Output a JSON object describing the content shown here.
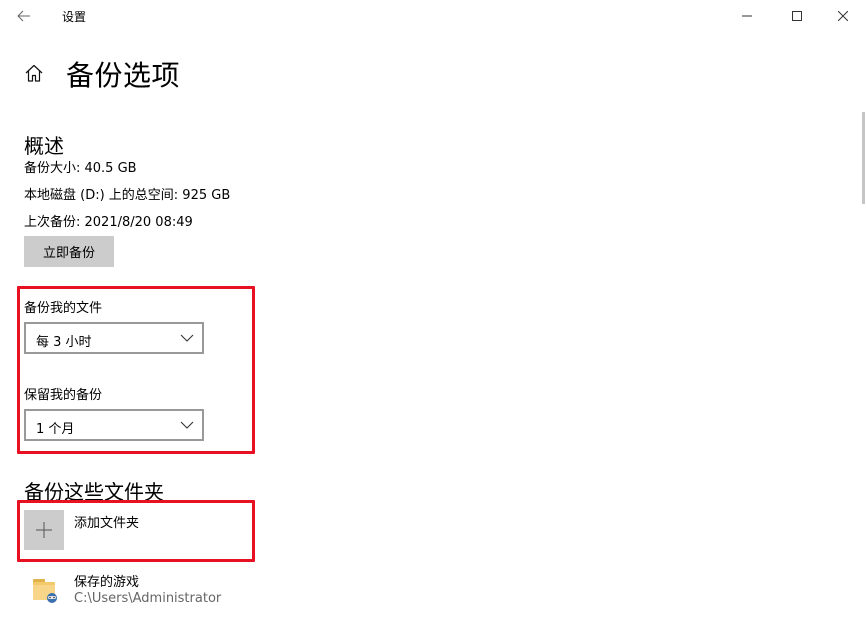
{
  "window": {
    "title": "设置"
  },
  "page": {
    "title": "备份选项"
  },
  "overview": {
    "title": "概述",
    "backup_size": "备份大小: 40.5 GB",
    "total_space": "本地磁盘 (D:) 上的总空间: 925 GB",
    "last_backup": "上次备份: 2021/8/20 08:49",
    "backup_now_label": "立即备份"
  },
  "settings": {
    "frequency_label": "备份我的文件",
    "frequency_value": "每 3 小时",
    "retention_label": "保留我的备份",
    "retention_value": "1 个月"
  },
  "folders": {
    "title": "备份这些文件夹",
    "add_label": "添加文件夹",
    "items": [
      {
        "name": "保存的游戏",
        "path": "C:\\Users\\Administrator"
      }
    ]
  },
  "colors": {
    "highlight": "#e81123",
    "button_bg": "#cccccc",
    "secondary_text": "#666666"
  },
  "icons": [
    "back-arrow-icon",
    "minimize-icon",
    "maximize-icon",
    "close-icon",
    "home-icon",
    "chevron-down-icon",
    "plus-icon",
    "folder-icon"
  ]
}
